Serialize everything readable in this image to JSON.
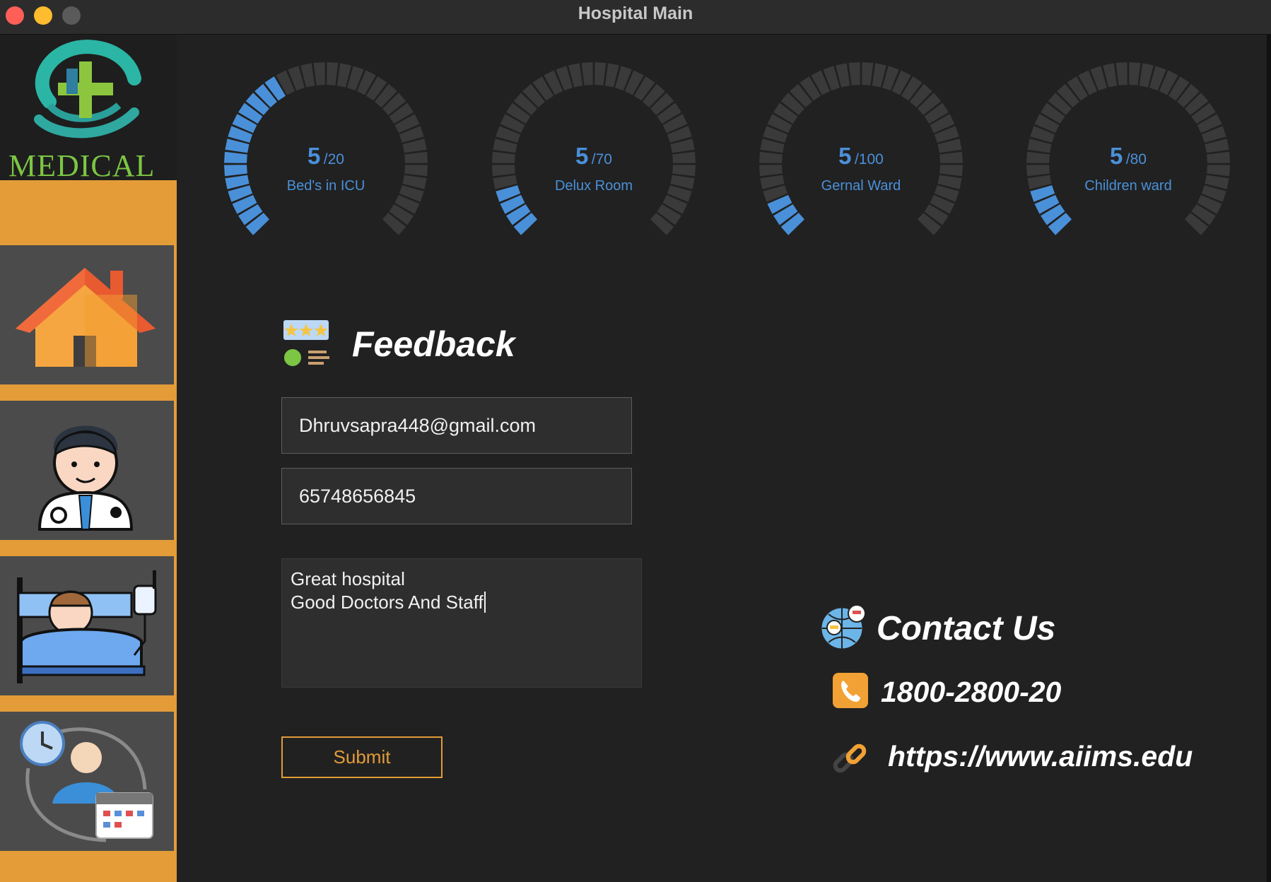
{
  "window": {
    "title": "Hospital Main"
  },
  "logo": {
    "text": "MEDICAL"
  },
  "sidebar": {
    "items": [
      {
        "name": "home",
        "icon": "house-icon"
      },
      {
        "name": "doctors",
        "icon": "doctor-icon"
      },
      {
        "name": "patients",
        "icon": "patient-bed-icon"
      },
      {
        "name": "appointments",
        "icon": "appointment-schedule-icon"
      }
    ]
  },
  "gauges": [
    {
      "value": "5",
      "max": "/20",
      "label": "Bed's in ICU",
      "fraction": 0.25
    },
    {
      "value": "5",
      "max": "/70",
      "label": "Delux Room",
      "fraction": 0.0714
    },
    {
      "value": "5",
      "max": "/100",
      "label": "Gernal Ward",
      "fraction": 0.05
    },
    {
      "value": "5",
      "max": "/80",
      "label": "Children ward",
      "fraction": 0.0625
    }
  ],
  "feedback": {
    "title": "Feedback",
    "email_value": "Dhruvsapra448@gmail.com",
    "phone_value": "65748656845",
    "message_line1": "Great hospital",
    "message_line2": "Good Doctors And Staff",
    "submit_label": "Submit"
  },
  "contact": {
    "title": "Contact Us",
    "phone": "1800-2800-20",
    "website": "https://www.aiims.edu"
  },
  "colors": {
    "accent": "#e39c38",
    "gauge_fill": "#4a90d9",
    "gauge_track": "#3a3a3a",
    "logo_green": "#7cc644"
  }
}
